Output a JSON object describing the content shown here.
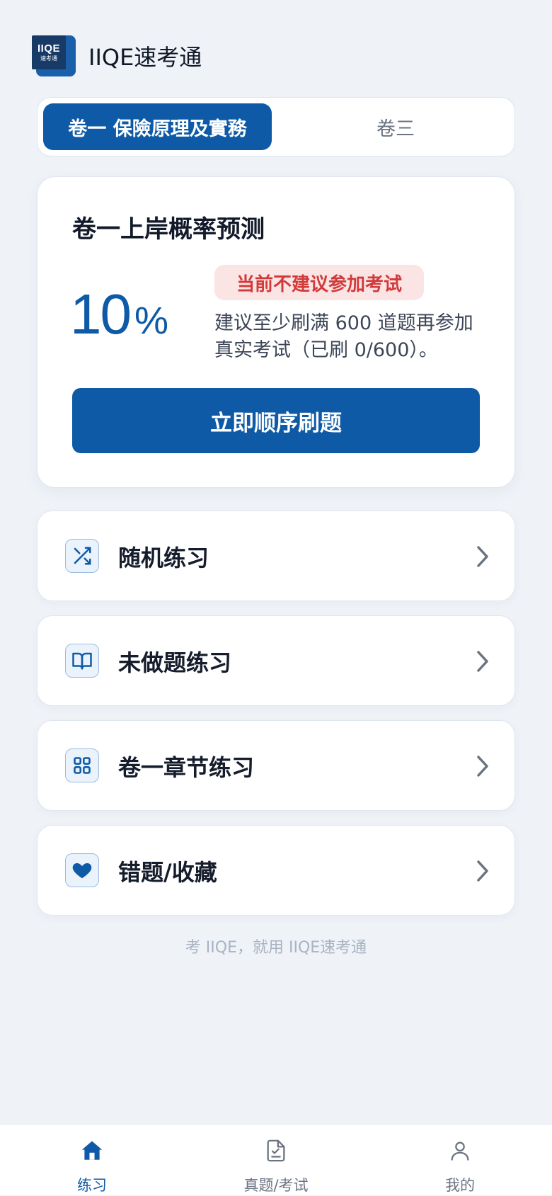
{
  "app": {
    "logo_line1": "IIQE",
    "logo_line2": "速考通",
    "title": "IIQE速考通"
  },
  "tabs": [
    {
      "label": "卷一 保險原理及實務",
      "active": true
    },
    {
      "label": "卷三",
      "active": false
    }
  ],
  "prediction": {
    "title": "卷一上岸概率预测",
    "value": "10",
    "unit": "%",
    "badge": "当前不建议参加考试",
    "advice": "建议至少刷满 600 道题再参加真实考试（已刷 0/600）。",
    "button_label": "立即顺序刷题"
  },
  "menu": [
    {
      "label": "随机练习",
      "icon": "shuffle-icon"
    },
    {
      "label": "未做题练习",
      "icon": "book-icon"
    },
    {
      "label": "卷一章节练习",
      "icon": "grid-icon"
    },
    {
      "label": "错题/收藏",
      "icon": "heart-icon"
    }
  ],
  "footer_note": "考 IIQE，就用 IIQE速考通",
  "bottom_nav": [
    {
      "label": "练习",
      "icon": "home-icon",
      "active": true
    },
    {
      "label": "真题/考试",
      "icon": "document-icon",
      "active": false
    },
    {
      "label": "我的",
      "icon": "user-icon",
      "active": false
    }
  ],
  "colors": {
    "primary": "#0f5aa6",
    "warning_text": "#d23a3a",
    "warning_bg": "#fbe4e4",
    "background": "#eff3f8"
  }
}
